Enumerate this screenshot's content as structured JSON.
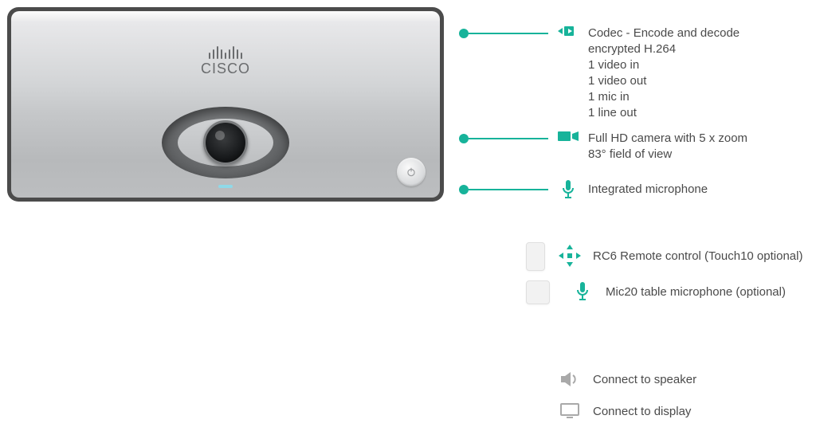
{
  "brand": "CISCO",
  "callouts": {
    "codec": {
      "line1": "Codec - Encode and decode",
      "line2": "encrypted H.264",
      "line3": "1 video in",
      "line4": "1 video out",
      "line5": "1 mic in",
      "line6": "1 line out"
    },
    "camera": {
      "line1": "Full HD camera with 5 x zoom",
      "line2": "83° field of view"
    },
    "mic": {
      "line1": "Integrated microphone"
    },
    "remote": {
      "line1": "RC6 Remote control (Touch10 optional)"
    },
    "tablemic": {
      "line1": "Mic20 table microphone (optional)"
    },
    "speaker": {
      "line1": "Connect to speaker"
    },
    "display": {
      "line1": "Connect to display"
    }
  }
}
